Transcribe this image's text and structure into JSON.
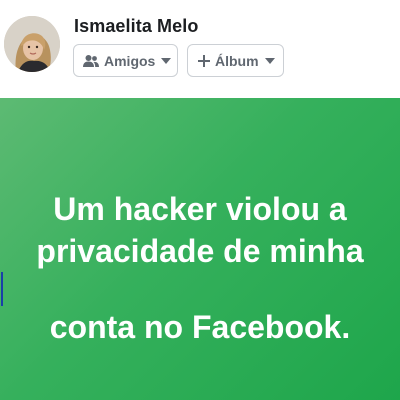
{
  "profile": {
    "name": "Ismaelita Melo",
    "avatar_icon": "profile-photo"
  },
  "audience_button": {
    "label": "Amigos",
    "icon": "friends-icon",
    "dropdown_icon": "caret-down-icon"
  },
  "album_button": {
    "label": "Álbum",
    "icon": "plus-icon",
    "dropdown_icon": "caret-down-icon"
  },
  "post": {
    "lines": [
      "Um hacker violou a",
      "privacidade de minha",
      "conta no Facebook."
    ],
    "background_colors": [
      "#5dba73",
      "#1ea64b"
    ],
    "text_color": "#ffffff"
  }
}
